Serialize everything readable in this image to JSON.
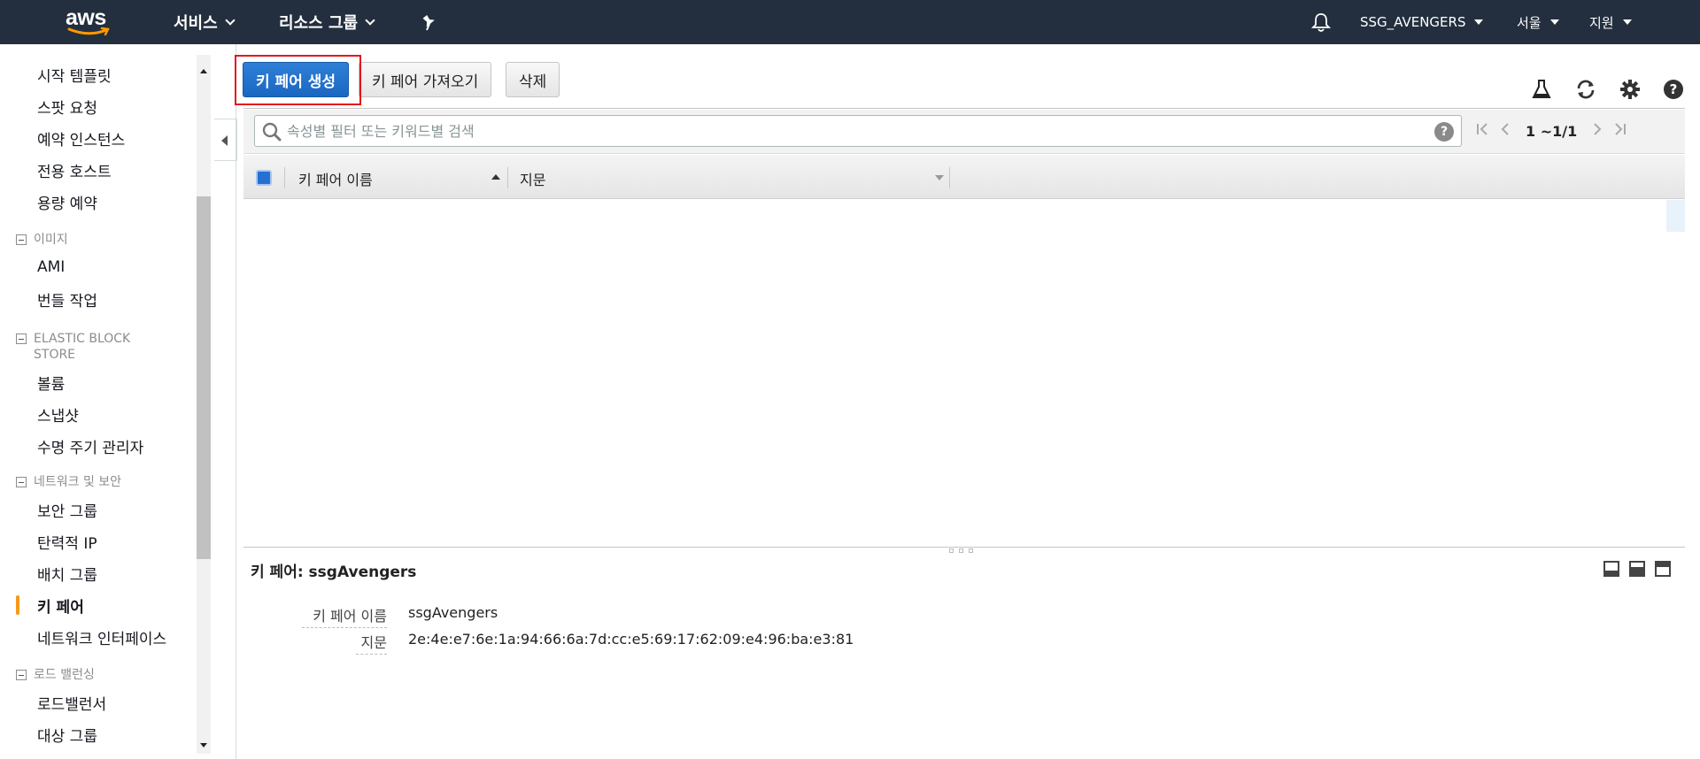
{
  "topnav": {
    "logo": "aws",
    "services": "서비스",
    "resource_groups": "리소스 그룹",
    "account": "SSG_AVENGERS",
    "region": "서울",
    "support": "지원",
    "icons": [
      "pin-icon",
      "bell-icon"
    ]
  },
  "sidebar": {
    "top_items": [
      "시작 템플릿",
      "스팟 요청",
      "예약 인스턴스",
      "전용 호스트",
      "용량 예약"
    ],
    "sections": [
      {
        "title": "이미지",
        "items": [
          "AMI",
          "번들 작업"
        ]
      },
      {
        "title": "ELASTIC BLOCK STORE",
        "items": [
          "볼륨",
          "스냅샷",
          "수명 주기 관리자"
        ]
      },
      {
        "title": "네트워크 및 보안",
        "items": [
          "보안 그룹",
          "탄력적 IP",
          "배치 그룹",
          "키 페어",
          "네트워크 인터페이스"
        ]
      },
      {
        "title": "로드 밸런싱",
        "items": [
          "로드밸런서",
          "대상 그룹"
        ]
      }
    ],
    "active_item": "키 페어"
  },
  "toolbar": {
    "create_label": "키 페어 생성",
    "import_label": "키 페어 가져오기",
    "delete_label": "삭제",
    "icons": [
      "flask-icon",
      "refresh-icon",
      "gear-icon",
      "help-icon"
    ]
  },
  "search": {
    "placeholder": "속성별 필터 또는 키워드별 검색",
    "help": "?"
  },
  "pager": {
    "text": "1 ~1/1"
  },
  "table": {
    "columns": [
      "키 페어 이름",
      "지문"
    ],
    "rows": []
  },
  "detail": {
    "title": "키 페어: ssgAvengers",
    "fields": [
      {
        "label": "키 페어 이름",
        "value": "ssgAvengers"
      },
      {
        "label": "지문",
        "value": "2e:4e:e7:6e:1a:94:66:6a:7d:cc:e5:69:17:62:09:e4:96:ba:e3:81"
      }
    ]
  },
  "colors": {
    "nav_bg": "#232f3e",
    "primary_button": "#1a67c1",
    "active_marker": "#f59a1a",
    "highlight_border": "#e3161c"
  }
}
